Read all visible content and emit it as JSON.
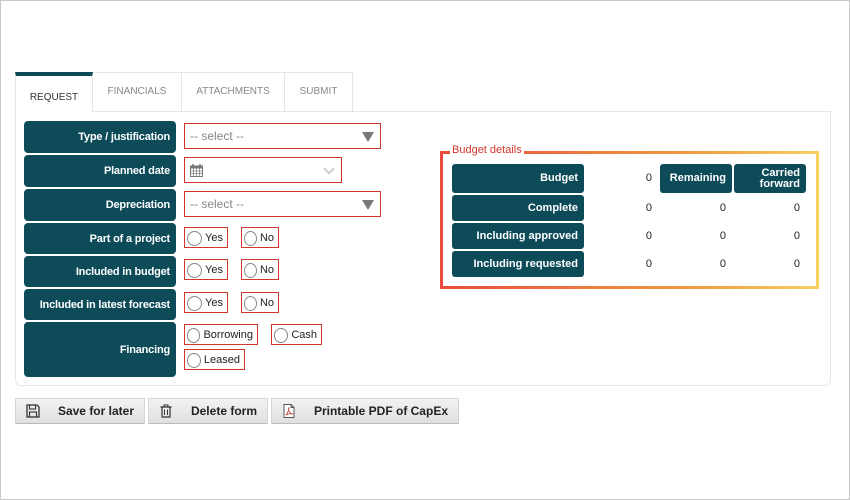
{
  "tabs": [
    {
      "label": "REQUEST",
      "active": true
    },
    {
      "label": "FINANCIALS",
      "active": false
    },
    {
      "label": "ATTACHMENTS",
      "active": false
    },
    {
      "label": "SUBMIT",
      "active": false
    }
  ],
  "form": {
    "type_justification": {
      "label": "Type / justification",
      "placeholder": "-- select --"
    },
    "planned_date": {
      "label": "Planned date",
      "value": ""
    },
    "depreciation": {
      "label": "Depreciation",
      "placeholder": "-- select --"
    },
    "part_of_project": {
      "label": "Part of a project",
      "options": [
        "Yes",
        "No"
      ]
    },
    "included_in_budget": {
      "label": "Included in budget",
      "options": [
        "Yes",
        "No"
      ]
    },
    "included_in_forecast": {
      "label": "Included in latest forecast",
      "options": [
        "Yes",
        "No"
      ]
    },
    "financing": {
      "label": "Financing",
      "options": [
        "Borrowing",
        "Cash",
        "Leased"
      ]
    }
  },
  "budget_details": {
    "legend": "Budget details",
    "headers": {
      "remaining": "Remaining",
      "carried_forward_1": "Carried",
      "carried_forward_2": "forward"
    },
    "rows": [
      {
        "label": "Budget",
        "budget": "0"
      },
      {
        "label": "Complete",
        "budget": "0",
        "remaining": "0",
        "carried_forward": "0"
      },
      {
        "label": "Including approved",
        "budget": "0",
        "remaining": "0",
        "carried_forward": "0"
      },
      {
        "label": "Including requested",
        "budget": "0",
        "remaining": "0",
        "carried_forward": "0"
      }
    ]
  },
  "buttons": {
    "save": "Save for later",
    "delete": "Delete form",
    "pdf": "Printable PDF of CapEx"
  }
}
